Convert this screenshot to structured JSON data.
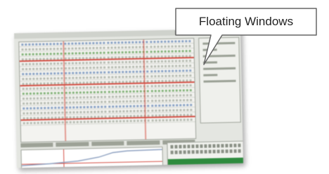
{
  "callout": {
    "text": "Floating Windows"
  },
  "colors": {
    "screenshot_bg": "#e4e6e1",
    "grid_highlight": "#d44f44",
    "status_bar": "#2e8b3e",
    "callout_border": "#666666"
  },
  "icons": [
    "callout-pointer"
  ]
}
